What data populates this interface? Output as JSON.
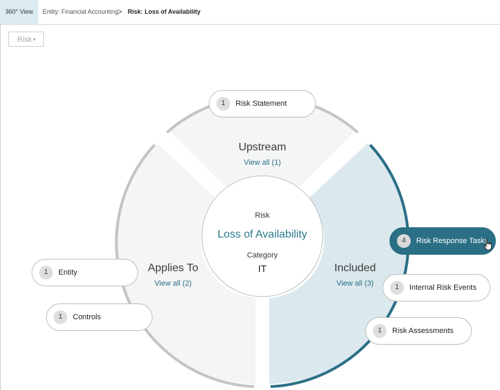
{
  "breadcrumb": {
    "tab": "360° View",
    "entity": "Entity: Financial Accounting",
    "separator": ">",
    "current": "Risk: Loss of Availability"
  },
  "filter": {
    "label": "Risk",
    "caret": "▾"
  },
  "center": {
    "type_label": "Risk",
    "name": "Loss of Availability",
    "category_label": "Category",
    "category_value": "IT"
  },
  "sections": {
    "upstream": {
      "title": "Upstream",
      "link": "View all (1)"
    },
    "applies_to": {
      "title": "Applies To",
      "link": "View all (2)"
    },
    "included": {
      "title": "Included",
      "link": "View all (3)"
    }
  },
  "pills": [
    {
      "count": "1",
      "label": "Risk Statement"
    },
    {
      "count": "4",
      "label": "Risk Response Tasks"
    },
    {
      "count": "1",
      "label": "Entity"
    },
    {
      "count": "1",
      "label": "Internal Risk Events"
    },
    {
      "count": "1",
      "label": "Controls"
    },
    {
      "count": "1",
      "label": "Risk Assessments"
    }
  ],
  "colors": {
    "accent": "#2b6f86",
    "sector_light": "#f4f5f5",
    "sector_selected": "#dbe9ee",
    "ring": "#c4c4c4"
  },
  "icons": {
    "cursor": "hand-pointer-icon",
    "caret": "caret-down-icon",
    "separator": "chevron-right-icon"
  }
}
